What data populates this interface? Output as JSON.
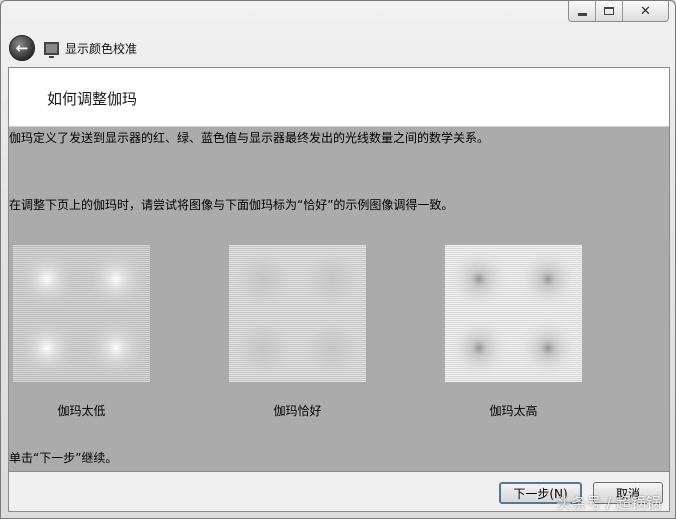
{
  "window": {
    "title": "显示颜色校准",
    "caption_buttons": {
      "minimize": "minimize-icon",
      "maximize": "maximize-icon",
      "close": "✕"
    }
  },
  "navbar": {
    "back_icon": "back-arrow-icon",
    "app_icon": "monitor-icon",
    "title": "显示颜色校准"
  },
  "page": {
    "heading": "如何调整伽玛",
    "para1": "伽玛定义了发送到显示器的红、绿、蓝色值与显示器最终发出的光线数量之间的数学关系。",
    "para2": "在调整下页上的伽玛时，请尝试将图像与下面伽玛标为“恰好”的示例图像调得一致。",
    "para3": "单击“下一步”继续。"
  },
  "samples": [
    {
      "label": "伽玛太低",
      "dot_style": "light"
    },
    {
      "label": "伽玛恰好",
      "dot_style": "none"
    },
    {
      "label": "伽玛太高",
      "dot_style": "dark"
    }
  ],
  "footer": {
    "next_label": "下一步(N)",
    "cancel_label": "取消"
  },
  "watermark": "头条号 / 超锅锅",
  "colors": {
    "content_bg": "#ababab",
    "header_bg": "#ffffff",
    "footer_bg": "#f0f0f0"
  }
}
